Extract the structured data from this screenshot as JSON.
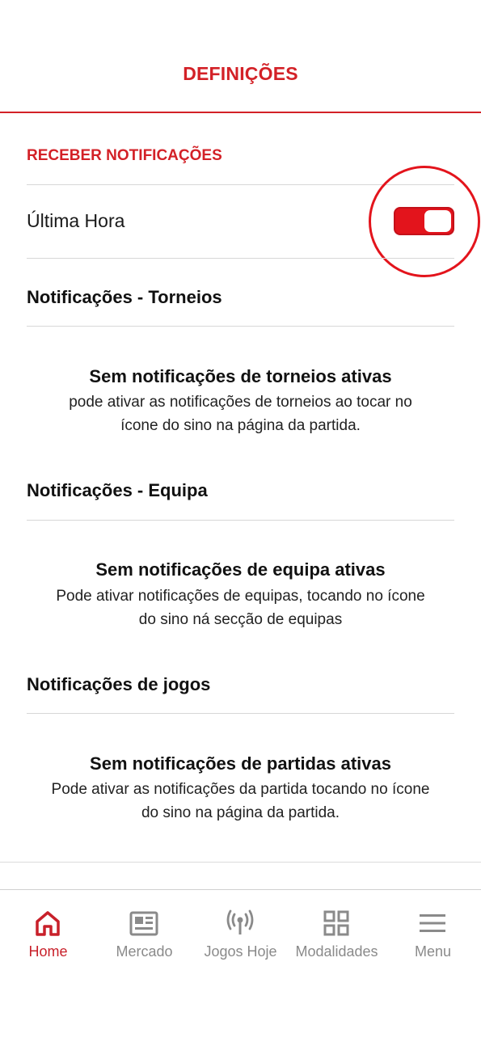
{
  "header": {
    "title": "DEFINIÇÕES"
  },
  "notifications": {
    "section_label": "RECEBER NOTIFICAÇÕES",
    "breaking": {
      "label": "Última Hora",
      "enabled": true
    }
  },
  "tournaments": {
    "heading": "Notificações - Torneios",
    "empty_title": "Sem notificações de torneios ativas",
    "empty_desc_line1": "pode ativar as notificações de torneios ao tocar no",
    "empty_desc_line2": "ícone do sino na página da partida."
  },
  "team": {
    "heading": "Notificações - Equipa",
    "empty_title": "Sem notificações de equipa ativas",
    "empty_desc_line1": "Pode ativar notificações de equipas, tocando no ícone",
    "empty_desc_line2": "do sino ná secção de equipas"
  },
  "games": {
    "heading": "Notificações de jogos",
    "empty_title": "Sem notificações de partidas ativas",
    "empty_desc_line1": "Pode ativar as notificações da partida tocando no ícone",
    "empty_desc_line2": "do sino na página da partida."
  },
  "bottom_nav": {
    "items": [
      {
        "label": "Home",
        "icon": "home-icon",
        "active": true
      },
      {
        "label": "Mercado",
        "icon": "newspaper-icon",
        "active": false
      },
      {
        "label": "Jogos Hoje",
        "icon": "broadcast-icon",
        "active": false
      },
      {
        "label": "Modalidades",
        "icon": "grid-icon",
        "active": false
      },
      {
        "label": "Menu",
        "icon": "hamburger-menu-icon",
        "active": false
      }
    ]
  },
  "colors": {
    "accent": "#d32127",
    "inactive": "#8a8a8a"
  }
}
